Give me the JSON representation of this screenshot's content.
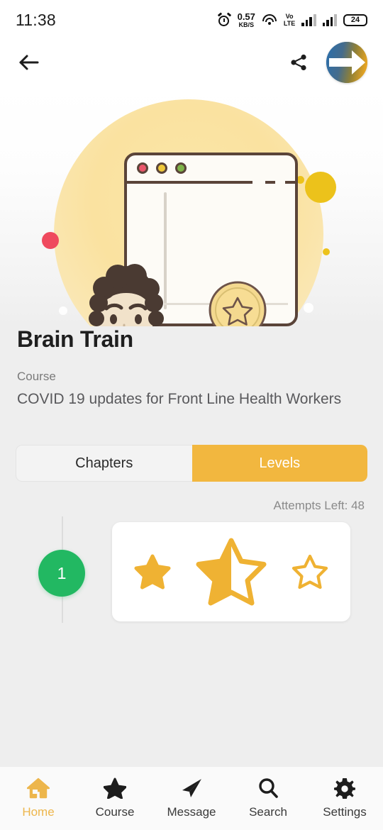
{
  "status_bar": {
    "time": "11:38",
    "alarm_icon": "alarm-icon",
    "net_speed_value": "0.57",
    "net_speed_unit": "KB/S",
    "wifi_icon": "wifi-icon",
    "volte_top": "Vo",
    "volte_bottom": "LTE",
    "signal_icon": "signal-bars-icon",
    "battery_level": "24"
  },
  "app_bar": {
    "back_icon": "back-arrow-icon",
    "share_icon": "share-icon",
    "avatar_icon": "user-avatar-logo"
  },
  "hero": {
    "illustration_name": "course-achievement-illustration",
    "accent_yellow": "#fae2a0",
    "accent_gold": "#ecc21b",
    "accent_red": "#ef4a5e",
    "accent_pink": "#f08a9b"
  },
  "info": {
    "title": "Brain Train",
    "type_label": "Course",
    "description": "COVID 19 updates for Front Line Health Workers"
  },
  "tabs": {
    "chapters_label": "Chapters",
    "levels_label": "Levels",
    "active": "Levels",
    "active_color": "#f2b73f"
  },
  "levels": {
    "attempts_text": "Attempts Left: 48",
    "items": [
      {
        "number": "1",
        "badge_color": "#22b862",
        "stars": [
          {
            "state": "full",
            "size": "small"
          },
          {
            "state": "half",
            "size": "large"
          },
          {
            "state": "empty",
            "size": "small"
          }
        ],
        "star_color": "#efb233"
      }
    ]
  },
  "bottom_nav": {
    "items": [
      {
        "label": "Home",
        "icon": "home-icon",
        "active": true
      },
      {
        "label": "Course",
        "icon": "star-icon",
        "active": false
      },
      {
        "label": "Message",
        "icon": "paper-plane-icon",
        "active": false
      },
      {
        "label": "Search",
        "icon": "magnifier-icon",
        "active": false
      },
      {
        "label": "Settings",
        "icon": "gear-icon",
        "active": false
      }
    ],
    "active_color": "#edb64c",
    "inactive_color": "#3a3a3a"
  }
}
